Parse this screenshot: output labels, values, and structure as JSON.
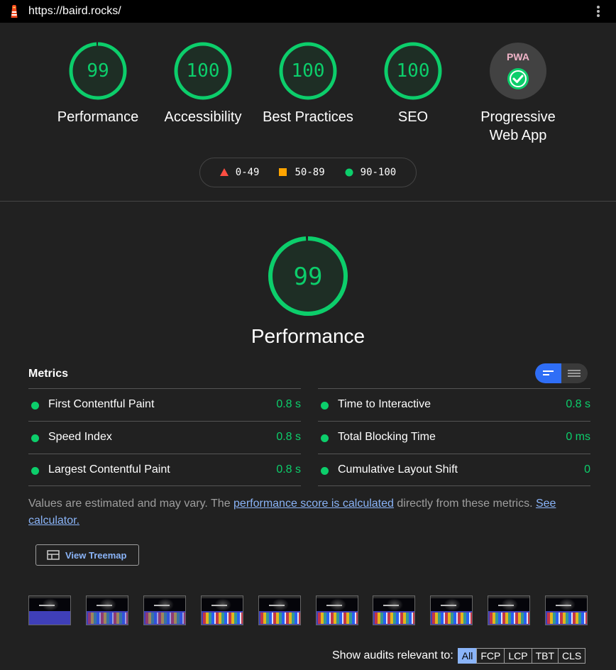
{
  "browser": {
    "url": "https://baird.rocks/",
    "logo_icon": "lighthouse-icon",
    "menu_icon": "kebab-menu-icon"
  },
  "categories": [
    {
      "score": "99",
      "label": "Performance",
      "fraction": 0.99
    },
    {
      "score": "100",
      "label": "Accessibility",
      "fraction": 1.0
    },
    {
      "score": "100",
      "label": "Best Practices",
      "fraction": 1.0
    },
    {
      "score": "100",
      "label": "SEO",
      "fraction": 1.0
    }
  ],
  "pwa": {
    "badge": "PWA",
    "label_line1": "Progressive",
    "label_line2": "Web App",
    "icon": "check-icon"
  },
  "legend": [
    {
      "range": "0-49",
      "shape": "triangle",
      "color": "#ff4e42"
    },
    {
      "range": "50-89",
      "shape": "square",
      "color": "#ffa400"
    },
    {
      "range": "90-100",
      "shape": "circle",
      "color": "#0cce6b"
    }
  ],
  "performance": {
    "score": "99",
    "fraction": 0.99,
    "title": "Performance"
  },
  "metrics": {
    "header": "Metrics",
    "left": [
      {
        "name": "First Contentful Paint",
        "value": "0.8 s"
      },
      {
        "name": "Speed Index",
        "value": "0.8 s"
      },
      {
        "name": "Largest Contentful Paint",
        "value": "0.8 s"
      }
    ],
    "right": [
      {
        "name": "Time to Interactive",
        "value": "0.8 s"
      },
      {
        "name": "Total Blocking Time",
        "value": "0 ms"
      },
      {
        "name": "Cumulative Layout Shift",
        "value": "0"
      }
    ],
    "view_toggle": {
      "active": "summary-view-icon",
      "inactive": "detail-view-icon"
    }
  },
  "note": {
    "text1": "Values are estimated and may vary. The ",
    "link1": "performance score is calculated",
    "text2": " directly from these metrics. ",
    "link2": "See calculator."
  },
  "treemap": {
    "label": "View Treemap",
    "icon": "treemap-icon"
  },
  "filmstrip_count": 10,
  "audit_filter": {
    "label": "Show audits relevant to:",
    "options": [
      "All",
      "FCP",
      "LCP",
      "TBT",
      "CLS"
    ],
    "active": "All"
  },
  "colors": {
    "pass": "#0cce6b",
    "link": "#8ab4f8",
    "background": "#212121"
  }
}
